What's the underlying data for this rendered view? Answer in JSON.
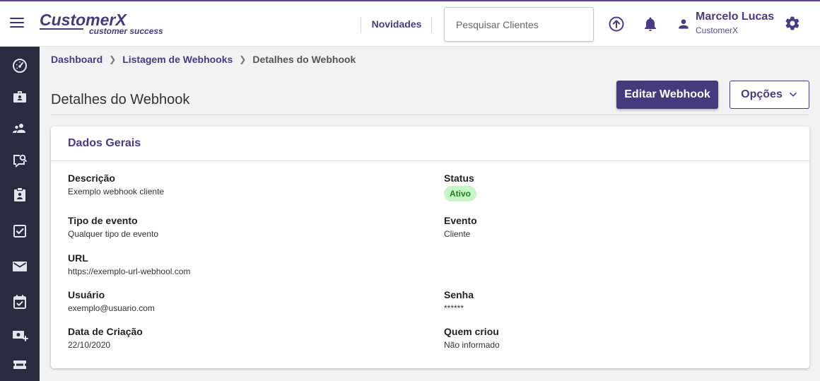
{
  "colors": {
    "accent": "#4a3a85",
    "sidebar": "#2c2b3f",
    "status_active_bg": "#c6f5c6",
    "status_active_text": "#237a23"
  },
  "header": {
    "logo_main": "CustomerX",
    "logo_sub": "customer success",
    "novidades_label": "Novidades",
    "search_placeholder": "Pesquisar Clientes",
    "icons": [
      "menu-icon",
      "upload-icon",
      "bell-icon",
      "user-icon",
      "gear-icon"
    ],
    "user_name": "Marcelo Lucas",
    "user_org": "CustomerX"
  },
  "sidebar": {
    "items": [
      "speedometer-icon",
      "briefcase-icon",
      "groups-icon",
      "chat-search-icon",
      "clipboard-user-icon",
      "checkbox-icon",
      "mail-icon",
      "calendar-check-icon",
      "money-add-icon",
      "ticket-icon"
    ]
  },
  "breadcrumb": {
    "items": [
      "Dashboard",
      "Listagem de Webhooks",
      "Detalhes do Webhook"
    ]
  },
  "page": {
    "title": "Detalhes do Webhook",
    "edit_button": "Editar Webhook",
    "options_button": "Opções"
  },
  "card": {
    "title": "Dados Gerais",
    "fields": {
      "descricao": {
        "label": "Descrição",
        "value": "Exemplo webhook cliente"
      },
      "status": {
        "label": "Status",
        "value": "Ativo"
      },
      "tipo_evento": {
        "label": "Tipo de evento",
        "value": "Qualquer tipo de evento"
      },
      "evento": {
        "label": "Evento",
        "value": "Cliente"
      },
      "url": {
        "label": "URL",
        "value": "https://exemplo-url-webhool.com"
      },
      "usuario": {
        "label": "Usuário",
        "value": "exemplo@usuario.com"
      },
      "senha": {
        "label": "Senha",
        "value": "******"
      },
      "data_criacao": {
        "label": "Data de Criação",
        "value": "22/10/2020"
      },
      "quem_criou": {
        "label": "Quem criou",
        "value": "Não informado"
      }
    }
  }
}
